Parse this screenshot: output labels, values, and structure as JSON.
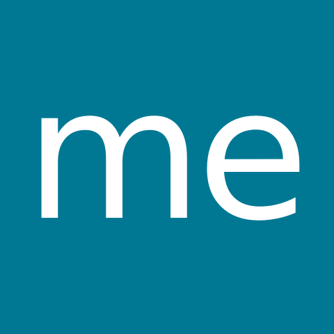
{
  "logo": {
    "text": "me",
    "background_color": "#007894",
    "text_color": "#ffffff"
  }
}
